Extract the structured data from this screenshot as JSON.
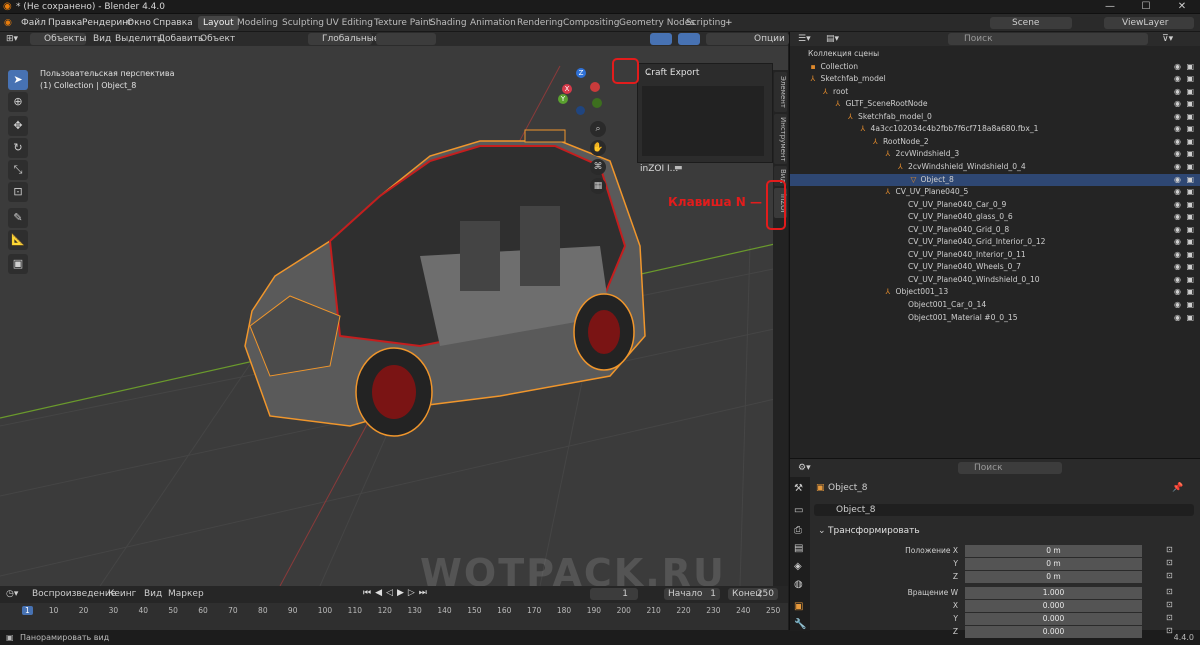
{
  "app": {
    "title": "* (Не сохранено) - Blender 4.4.0",
    "version": "4.4.0"
  },
  "menu": [
    "Файл",
    "Правка",
    "Рендеринг",
    "Окно",
    "Справка"
  ],
  "workspaces": [
    "Layout",
    "Modeling",
    "Sculpting",
    "UV Editing",
    "Texture Paint",
    "Shading",
    "Animation",
    "Rendering",
    "Compositing",
    "Geometry Nodes",
    "Scripting"
  ],
  "scene": "Scene",
  "viewlayer": "ViewLayer",
  "vphdr": {
    "mode": "Объекты",
    "view": "Вид",
    "select": "Выделить",
    "add": "Добавить",
    "object": "Объект",
    "orient": "Глобальные",
    "options": "Опции"
  },
  "viewport": {
    "persp": "Пользовательская перспектива",
    "coll": "(1) Collection | Object_8"
  },
  "gizmo": {
    "x": "X",
    "y": "Y",
    "z": "Z"
  },
  "npanel": {
    "title": "Craft Export",
    "path": "inZOI I..."
  },
  "rtabs": [
    "Элемент",
    "Инструмент",
    "Вид",
    "inZOI"
  ],
  "annotation": "Клавиша N",
  "watermark": "WOTPACK.RU",
  "outliner": {
    "search": "Поиск",
    "rows": [
      {
        "label": "Коллекция сцены",
        "d": 0,
        "icon": "",
        "eye": false
      },
      {
        "label": "Collection",
        "d": 1,
        "icon": "▪",
        "eye": true
      },
      {
        "label": "Sketchfab_model",
        "d": 1,
        "icon": "⅄",
        "eye": true
      },
      {
        "label": "root",
        "d": 2,
        "icon": "⅄",
        "eye": true
      },
      {
        "label": "GLTF_SceneRootNode",
        "d": 3,
        "icon": "⅄",
        "eye": true
      },
      {
        "label": "Sketchfab_model_0",
        "d": 4,
        "icon": "⅄",
        "eye": true
      },
      {
        "label": "4a3cc102034c4b2fbb7f6cf718a8a680.fbx_1",
        "d": 5,
        "icon": "⅄",
        "eye": true
      },
      {
        "label": "RootNode_2",
        "d": 6,
        "icon": "⅄",
        "eye": true
      },
      {
        "label": "2cvWindshield_3",
        "d": 7,
        "icon": "⅄",
        "eye": true
      },
      {
        "label": "2cvWindshield_Windshield_0_4",
        "d": 8,
        "icon": "⅄",
        "eye": true
      },
      {
        "label": "Object_8",
        "d": 9,
        "icon": "▽",
        "eye": true,
        "sel": true
      },
      {
        "label": "CV_UV_Plane040_5",
        "d": 7,
        "icon": "⅄",
        "eye": true
      },
      {
        "label": "CV_UV_Plane040_Car_0_9",
        "d": 8,
        "icon": "",
        "eye": true
      },
      {
        "label": "CV_UV_Plane040_glass_0_6",
        "d": 8,
        "icon": "",
        "eye": true
      },
      {
        "label": "CV_UV_Plane040_Grid_0_8",
        "d": 8,
        "icon": "",
        "eye": true
      },
      {
        "label": "CV_UV_Plane040_Grid_Interior_0_12",
        "d": 8,
        "icon": "",
        "eye": true
      },
      {
        "label": "CV_UV_Plane040_Interior_0_11",
        "d": 8,
        "icon": "",
        "eye": true
      },
      {
        "label": "CV_UV_Plane040_Wheels_0_7",
        "d": 8,
        "icon": "",
        "eye": true
      },
      {
        "label": "CV_UV_Plane040_Windshield_0_10",
        "d": 8,
        "icon": "",
        "eye": true
      },
      {
        "label": "Object001_13",
        "d": 7,
        "icon": "⅄",
        "eye": true
      },
      {
        "label": "Object001_Car_0_14",
        "d": 8,
        "icon": "",
        "eye": true
      },
      {
        "label": "Object001_Material #0_0_15",
        "d": 8,
        "icon": "",
        "eye": true
      }
    ]
  },
  "props": {
    "search": "Поиск",
    "object": "Object_8",
    "data": "Object_8",
    "section": "Трансформировать",
    "rows": [
      {
        "l": "Положение X",
        "v": "0 m"
      },
      {
        "l": "Y",
        "v": "0 m"
      },
      {
        "l": "Z",
        "v": "0 m"
      },
      {
        "l": "Вращение W",
        "v": "1.000"
      },
      {
        "l": "X",
        "v": "0.000"
      },
      {
        "l": "Y",
        "v": "0.000"
      },
      {
        "l": "Z",
        "v": "0.000"
      }
    ]
  },
  "timeline": {
    "playback": "Воспроизведение",
    "keying": "Кеинг",
    "view": "Вид",
    "marker": "Маркер",
    "frame": "1",
    "start_l": "Начало",
    "start": "1",
    "end_l": "Конец",
    "end": "250",
    "ticks": [
      "1",
      "10",
      "20",
      "30",
      "40",
      "50",
      "60",
      "70",
      "80",
      "90",
      "100",
      "110",
      "120",
      "130",
      "140",
      "150",
      "160",
      "170",
      "180",
      "190",
      "200",
      "210",
      "220",
      "230",
      "240",
      "250"
    ]
  },
  "status": {
    "hint": "Панорамировать вид",
    "ver": "4.4.0"
  }
}
